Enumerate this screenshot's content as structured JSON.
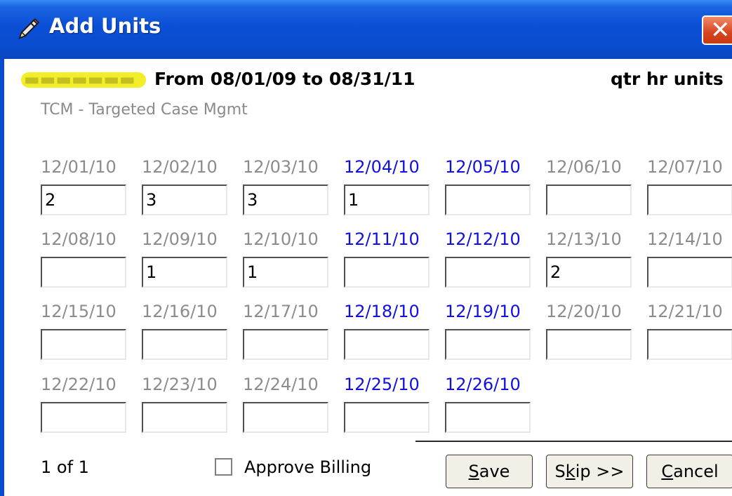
{
  "window": {
    "title": "Add Units",
    "close_glyph": "✕",
    "icon": "pencil-icon"
  },
  "header": {
    "client_name_redacted": "▬▬▬▬▬▬▬",
    "date_range": "From 08/01/09 to 08/31/11",
    "unit_type": "qtr hr units",
    "service": "TCM - Targeted Case Mgmt"
  },
  "colors": {
    "weekday": "#8c8c8c",
    "weekend": "#1010e0",
    "title_bar": "#0b4ccf"
  },
  "calendar": [
    [
      {
        "date": "12/01/10",
        "value": "2",
        "weekend": false
      },
      {
        "date": "12/02/10",
        "value": "3",
        "weekend": false
      },
      {
        "date": "12/03/10",
        "value": "3",
        "weekend": false
      },
      {
        "date": "12/04/10",
        "value": "1",
        "weekend": true
      },
      {
        "date": "12/05/10",
        "value": "",
        "weekend": true
      },
      {
        "date": "12/06/10",
        "value": "",
        "weekend": false
      },
      {
        "date": "12/07/10",
        "value": "",
        "weekend": false
      }
    ],
    [
      {
        "date": "12/08/10",
        "value": "",
        "weekend": false
      },
      {
        "date": "12/09/10",
        "value": "1",
        "weekend": false
      },
      {
        "date": "12/10/10",
        "value": "1",
        "weekend": false
      },
      {
        "date": "12/11/10",
        "value": "",
        "weekend": true
      },
      {
        "date": "12/12/10",
        "value": "",
        "weekend": true
      },
      {
        "date": "12/13/10",
        "value": "2",
        "weekend": false
      },
      {
        "date": "12/14/10",
        "value": "",
        "weekend": false
      }
    ],
    [
      {
        "date": "12/15/10",
        "value": "",
        "weekend": false
      },
      {
        "date": "12/16/10",
        "value": "",
        "weekend": false
      },
      {
        "date": "12/17/10",
        "value": "",
        "weekend": false
      },
      {
        "date": "12/18/10",
        "value": "",
        "weekend": true
      },
      {
        "date": "12/19/10",
        "value": "",
        "weekend": true
      },
      {
        "date": "12/20/10",
        "value": "",
        "weekend": false
      },
      {
        "date": "12/21/10",
        "value": "",
        "weekend": false
      }
    ],
    [
      {
        "date": "12/22/10",
        "value": "",
        "weekend": false
      },
      {
        "date": "12/23/10",
        "value": "",
        "weekend": false
      },
      {
        "date": "12/24/10",
        "value": "",
        "weekend": false
      },
      {
        "date": "12/25/10",
        "value": "",
        "weekend": true
      },
      {
        "date": "12/26/10",
        "value": "",
        "weekend": true
      }
    ]
  ],
  "footer": {
    "page_count": "1 of 1",
    "approve_billing_label": "Approve Billing",
    "approve_billing_checked": false,
    "save_access": "S",
    "save_rest": "ave",
    "skip_pre": "S",
    "skip_access": "k",
    "skip_rest": "ip >>",
    "cancel_access": "C",
    "cancel_rest": "ancel"
  }
}
